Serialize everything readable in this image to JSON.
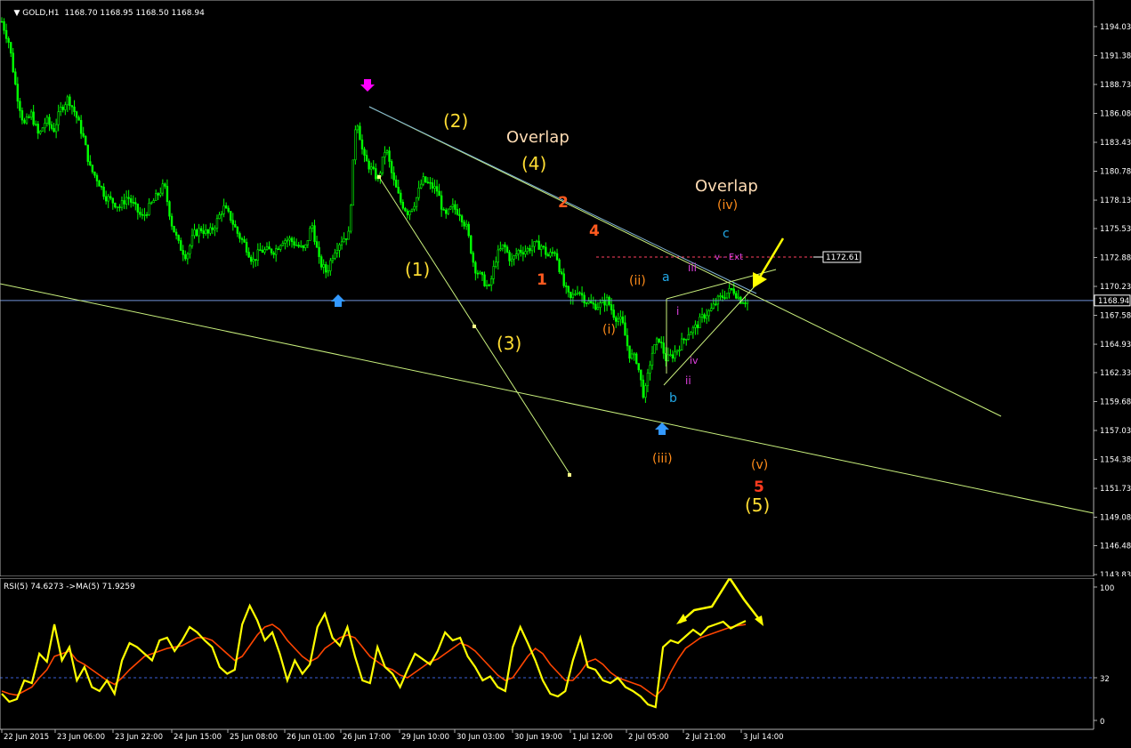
{
  "header": {
    "symbol": "GOLD,H1",
    "ohlc": "1168.70 1168.95 1168.50 1168.94"
  },
  "rsi_header": {
    "label": "RSI(5) 74.6273 ->MA(5) 71.9259"
  },
  "colors": {
    "background": "#000000",
    "candle_up": "#00ff00",
    "candle_down": "#00ff00",
    "rsi_line": "#ffff00",
    "ma_line": "#ff4500",
    "price_line": "#6f93d8",
    "trend_line": "#c9f07d",
    "arrow_yellow": "#ffff00",
    "arrow_blue": "#3399ff",
    "arrow_magenta": "#ff00ff"
  },
  "chart_data": [
    {
      "type": "candlestick",
      "title": "GOLD,H1",
      "ylim": [
        1143.83,
        1195.0
      ],
      "y_ticks": [
        "1194.03",
        "1191.38",
        "1188.73",
        "1186.08",
        "1183.43",
        "1180.78",
        "1178.13",
        "1175.53",
        "1172.88",
        "1170.23",
        "1167.58",
        "1164.93",
        "1162.33",
        "1159.68",
        "1157.03",
        "1154.38",
        "1151.73",
        "1149.08",
        "1146.48",
        "1143.83"
      ],
      "x_ticks": [
        "22 Jun 2015",
        "23 Jun 06:00",
        "23 Jun 22:00",
        "24 Jun 15:00",
        "25 Jun 08:00",
        "26 Jun 01:00",
        "26 Jun 17:00",
        "29 Jun 10:00",
        "30 Jun 03:00",
        "30 Jun 19:00",
        "1 Jul 12:00",
        "2 Jul 05:00",
        "2 Jul 21:00",
        "3 Jul 14:00"
      ],
      "current_price": "1168.94",
      "ext_label": "1172.61",
      "ext_text": "v - Ext",
      "close_path": [
        1194.5,
        1192.5,
        1188,
        1185,
        1186,
        1184,
        1185.5,
        1184.5,
        1186.5,
        1187.5,
        1186,
        1184,
        1181,
        1180,
        1178.5,
        1178,
        1177.5,
        1178.5,
        1177.5,
        1176.5,
        1177.5,
        1178.5,
        1179.5,
        1176,
        1174,
        1173,
        1175,
        1175.5,
        1175,
        1176,
        1177.5,
        1176.5,
        1175,
        1174,
        1172.5,
        1173.5,
        1173.5,
        1173.5,
        1174.5,
        1174.5,
        1174,
        1173.5,
        1176,
        1172.5,
        1171.5,
        1173.5,
        1174.5,
        1175,
        1186,
        1182,
        1181,
        1180,
        1183,
        1180,
        1178,
        1177,
        1178,
        1180,
        1179.5,
        1179,
        1176.5,
        1177.5,
        1177,
        1175.5,
        1172,
        1171,
        1170,
        1173,
        1174,
        1172.5,
        1173.5,
        1173.5,
        1174,
        1174,
        1173,
        1173.5,
        1170.5,
        1169,
        1170,
        1169,
        1168.5,
        1168.5,
        1169,
        1167.5,
        1167,
        1164,
        1163.5,
        1160,
        1164,
        1165.5,
        1163.5,
        1164,
        1165,
        1166,
        1166.5,
        1167.5,
        1168,
        1169,
        1169.5,
        1170,
        1169,
        1168.9
      ],
      "annotations": [
        {
          "text": "(2)",
          "color": "#ffdd33"
        },
        {
          "text": "Overlap",
          "color": "#ffdcb4"
        },
        {
          "text": "(4)",
          "color": "#ffdd33"
        },
        {
          "text": "2",
          "color": "#ff5a1f"
        },
        {
          "text": "4",
          "color": "#ff5a1f"
        },
        {
          "text": "Overlap",
          "color": "#ffdcb4"
        },
        {
          "text": "(iv)",
          "color": "#ff8c1a"
        },
        {
          "text": "c",
          "color": "#22a8e6"
        },
        {
          "text": "(1)",
          "color": "#ffdd33"
        },
        {
          "text": "1",
          "color": "#ff5a1f"
        },
        {
          "text": "(ii)",
          "color": "#ff8c1a"
        },
        {
          "text": "a",
          "color": "#22a8e6"
        },
        {
          "text": "iii",
          "color": "#e040e0"
        },
        {
          "text": "i",
          "color": "#e040e0"
        },
        {
          "text": "(3)",
          "color": "#ffdd33"
        },
        {
          "text": "(i)",
          "color": "#ff8c1a"
        },
        {
          "text": "iv",
          "color": "#e040e0"
        },
        {
          "text": "ii",
          "color": "#e040e0"
        },
        {
          "text": "b",
          "color": "#22a8e6"
        },
        {
          "text": "(iii)",
          "color": "#ff8c1a"
        },
        {
          "text": "(v)",
          "color": "#ff8c1a"
        },
        {
          "text": "5",
          "color": "#ff3b1f"
        },
        {
          "text": "(5)",
          "color": "#ffdd33"
        }
      ]
    },
    {
      "type": "line",
      "title": "RSI(5) 74.6273 ->MA(5) 71.9259",
      "ylim": [
        0,
        100
      ],
      "y_ticks": [
        "100",
        "32",
        "0"
      ],
      "level_line": 32,
      "series": [
        {
          "name": "RSI(5)",
          "values": [
            20,
            14,
            16,
            30,
            28,
            50,
            44,
            72,
            45,
            55,
            30,
            40,
            25,
            22,
            30,
            20,
            45,
            58,
            55,
            50,
            45,
            60,
            62,
            52,
            60,
            70,
            66,
            60,
            55,
            40,
            35,
            38,
            72,
            86,
            75,
            60,
            66,
            50,
            30,
            45,
            35,
            42,
            70,
            80,
            62,
            56,
            70,
            48,
            30,
            28,
            55,
            40,
            35,
            25,
            38,
            50,
            46,
            42,
            52,
            66,
            60,
            62,
            48,
            40,
            30,
            33,
            25,
            22,
            55,
            70,
            58,
            45,
            30,
            20,
            18,
            22,
            45,
            62,
            40,
            38,
            30,
            28,
            32,
            25,
            22,
            18,
            12,
            10,
            55,
            60,
            58,
            63,
            68,
            64,
            70,
            72,
            74,
            69,
            72,
            74.6
          ]
        },
        {
          "name": "MA(5)",
          "values": [
            22,
            20,
            19,
            22,
            25,
            32,
            38,
            48,
            50,
            52,
            45,
            42,
            38,
            34,
            30,
            27,
            32,
            38,
            43,
            48,
            50,
            52,
            54,
            55,
            56,
            59,
            62,
            62,
            60,
            55,
            50,
            45,
            48,
            56,
            64,
            70,
            72,
            68,
            60,
            54,
            48,
            44,
            47,
            54,
            58,
            62,
            64,
            62,
            55,
            48,
            44,
            40,
            38,
            34,
            32,
            36,
            40,
            44,
            46,
            50,
            54,
            58,
            56,
            52,
            46,
            40,
            34,
            30,
            32,
            40,
            48,
            54,
            50,
            42,
            36,
            30,
            30,
            36,
            44,
            46,
            42,
            36,
            32,
            30,
            28,
            26,
            22,
            18,
            24,
            36,
            46,
            54,
            58,
            62,
            64,
            66,
            68,
            70,
            71,
            71.9
          ]
        }
      ]
    }
  ]
}
